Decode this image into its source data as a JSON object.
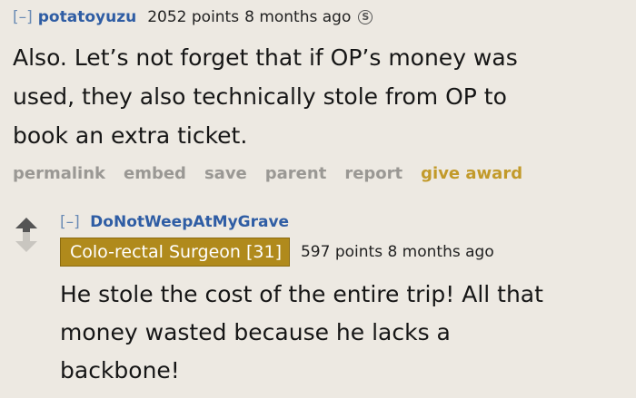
{
  "comment1": {
    "collapse": "[–]",
    "author": "potatoyuzu",
    "score": "2052 points",
    "time": "8 months ago",
    "silver_badge": "S",
    "body_lines": [
      "Also. Let’s not forget that if OP’s money was",
      "used, they also technically stole from OP to",
      "book an extra ticket."
    ],
    "actions": {
      "permalink": "permalink",
      "embed": "embed",
      "save": "save",
      "parent": "parent",
      "report": "report",
      "give_award": "give award"
    }
  },
  "comment2": {
    "collapse": "[–]",
    "author": "DoNotWeepAtMyGrave",
    "flair": "Colo-rectal Surgeon [31]",
    "score": "597 points 8 months ago",
    "body_lines": [
      "He stole the cost of the entire trip! All that",
      "money wasted because he lacks a",
      "backbone!"
    ]
  },
  "colors": {
    "background": "#ede9e2",
    "author": "#2f5da4",
    "award": "#c29a2a",
    "flair": "#b08a1c"
  }
}
